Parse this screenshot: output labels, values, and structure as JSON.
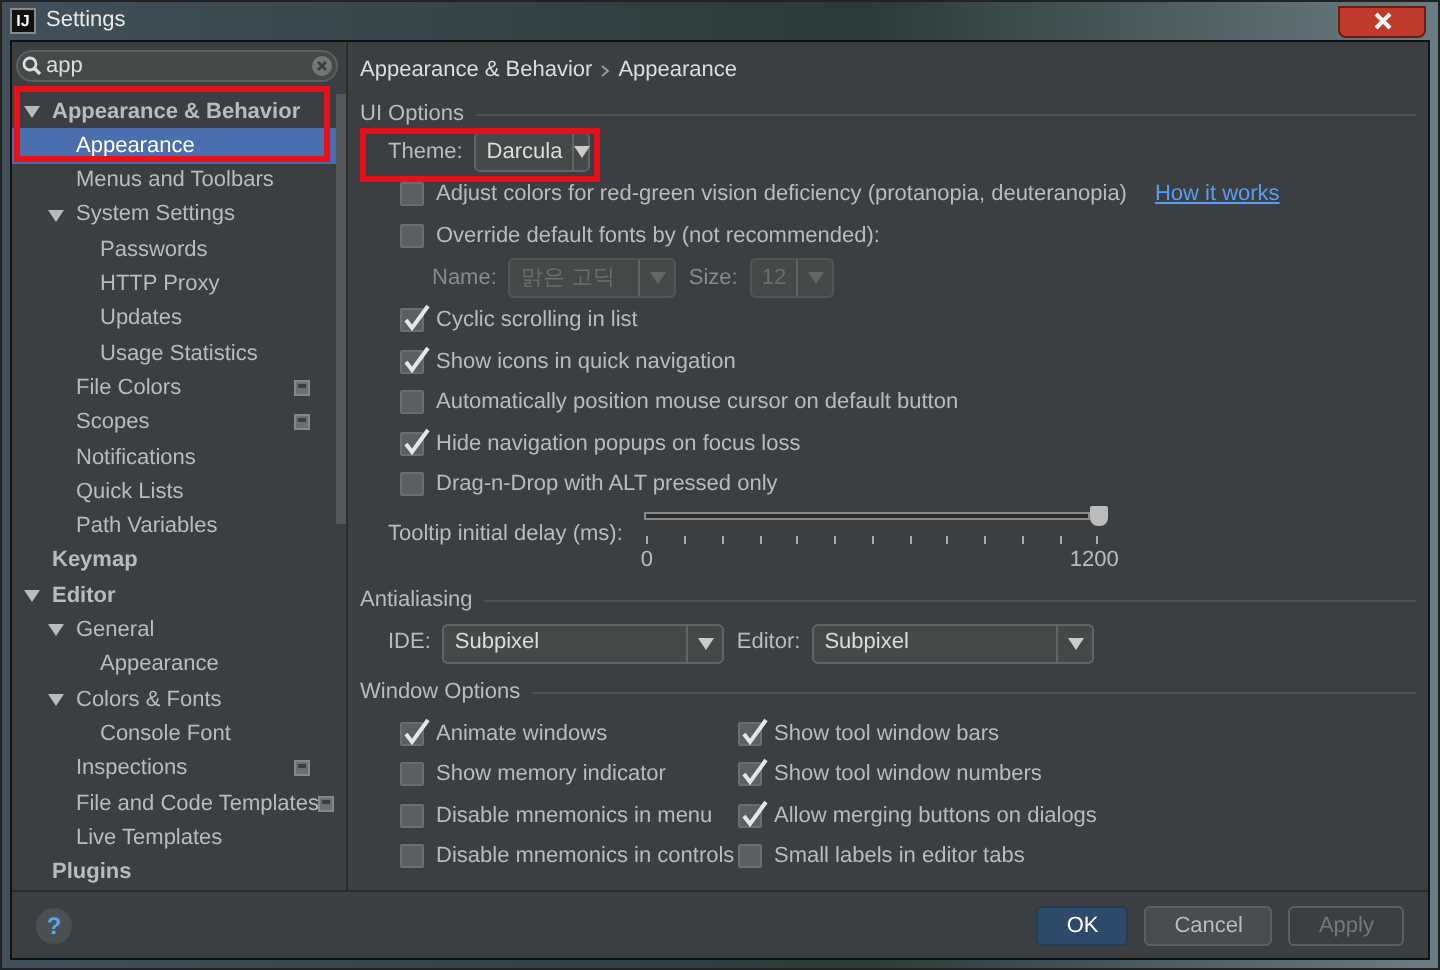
{
  "window": {
    "title": "Settings",
    "app_icon_text": "IJ"
  },
  "search": {
    "value": "app"
  },
  "tree": [
    {
      "label": "Appearance & Behavior",
      "expanded": true,
      "selected": false,
      "highlighted": true,
      "project_icon": false,
      "children": [
        {
          "label": "Appearance",
          "selected": true,
          "project_icon": false
        },
        {
          "label": "Menus and Toolbars",
          "selected": false,
          "project_icon": false
        },
        {
          "label": "System Settings",
          "expanded": true,
          "selected": false,
          "project_icon": false,
          "children": [
            {
              "label": "Passwords",
              "selected": false,
              "project_icon": false
            },
            {
              "label": "HTTP Proxy",
              "selected": false,
              "project_icon": false
            },
            {
              "label": "Updates",
              "selected": false,
              "project_icon": false
            },
            {
              "label": "Usage Statistics",
              "selected": false,
              "project_icon": false
            }
          ]
        },
        {
          "label": "File Colors",
          "selected": false,
          "project_icon": true
        },
        {
          "label": "Scopes",
          "selected": false,
          "project_icon": true
        },
        {
          "label": "Notifications",
          "selected": false,
          "project_icon": false
        },
        {
          "label": "Quick Lists",
          "selected": false,
          "project_icon": false
        },
        {
          "label": "Path Variables",
          "selected": false,
          "project_icon": false
        }
      ]
    },
    {
      "label": "Keymap",
      "selected": false,
      "highlighted": false,
      "project_icon": false
    },
    {
      "label": "Editor",
      "expanded": true,
      "selected": false,
      "highlighted": false,
      "project_icon": false,
      "children": [
        {
          "label": "General",
          "expanded": true,
          "selected": false,
          "project_icon": false,
          "children": [
            {
              "label": "Appearance",
              "selected": false,
              "project_icon": false
            }
          ]
        },
        {
          "label": "Colors & Fonts",
          "expanded": true,
          "selected": false,
          "project_icon": false,
          "children": [
            {
              "label": "Console Font",
              "selected": false,
              "project_icon": false
            }
          ]
        },
        {
          "label": "Inspections",
          "selected": false,
          "project_icon": true
        },
        {
          "label": "File and Code Templates",
          "selected": false,
          "project_icon": true
        },
        {
          "label": "Live Templates",
          "selected": false,
          "project_icon": false
        }
      ]
    },
    {
      "label": "Plugins",
      "selected": false,
      "highlighted": false,
      "project_icon": false
    }
  ],
  "breadcrumb": [
    "Appearance & Behavior",
    "Appearance"
  ],
  "ui_options": {
    "title": "UI Options",
    "theme": {
      "label": "Theme:",
      "value": "Darcula",
      "highlighted": true
    },
    "options": [
      {
        "kind": "checkbox",
        "label": "Adjust colors for red-green vision deficiency (protanopia, deuteranopia)",
        "checked": false,
        "link": "How it works"
      },
      {
        "kind": "checkbox",
        "label": "Override default fonts by (not recommended):",
        "checked": false
      },
      {
        "kind": "font",
        "name_label": "Name:",
        "name_value": "맑은 고딕",
        "size_label": "Size:",
        "size_value": "12",
        "disabled": true
      },
      {
        "kind": "checkbox",
        "label": "Cyclic scrolling in list",
        "checked": true
      },
      {
        "kind": "checkbox",
        "label": "Show icons in quick navigation",
        "checked": true
      },
      {
        "kind": "checkbox",
        "label": "Automatically position mouse cursor on default button",
        "checked": false
      },
      {
        "kind": "checkbox",
        "label": "Hide navigation popups on focus loss",
        "checked": true
      },
      {
        "kind": "checkbox",
        "label": "Drag-n-Drop with ALT pressed only",
        "checked": false
      }
    ],
    "tooltip_delay": {
      "label": "Tooltip initial delay (ms):",
      "level": 1,
      "min_label": "0",
      "max_label": "1200"
    }
  },
  "antialiasing": {
    "title": "Antialiasing",
    "ide_label": "IDE:",
    "ide_value": "Subpixel",
    "editor_label": "Editor:",
    "editor_value": "Subpixel"
  },
  "window_options": {
    "title": "Window Options",
    "columns": [
      [
        {
          "label": "Animate windows",
          "checked": true
        },
        {
          "label": "Show memory indicator",
          "checked": false
        },
        {
          "label": "Disable mnemonics in menu",
          "checked": false
        },
        {
          "label": "Disable mnemonics in controls",
          "checked": false
        }
      ],
      [
        {
          "label": "Show tool window bars",
          "checked": true
        },
        {
          "label": "Show tool window numbers",
          "checked": true
        },
        {
          "label": "Allow merging buttons on dialogs",
          "checked": true
        },
        {
          "label": "Small labels in editor tabs",
          "checked": false
        }
      ]
    ]
  },
  "help": "?",
  "buttons": [
    {
      "label": "OK",
      "kind": "default",
      "disabled": false
    },
    {
      "label": "Cancel",
      "kind": "normal",
      "disabled": false
    },
    {
      "label": "Apply",
      "kind": "normal",
      "disabled": true
    }
  ]
}
